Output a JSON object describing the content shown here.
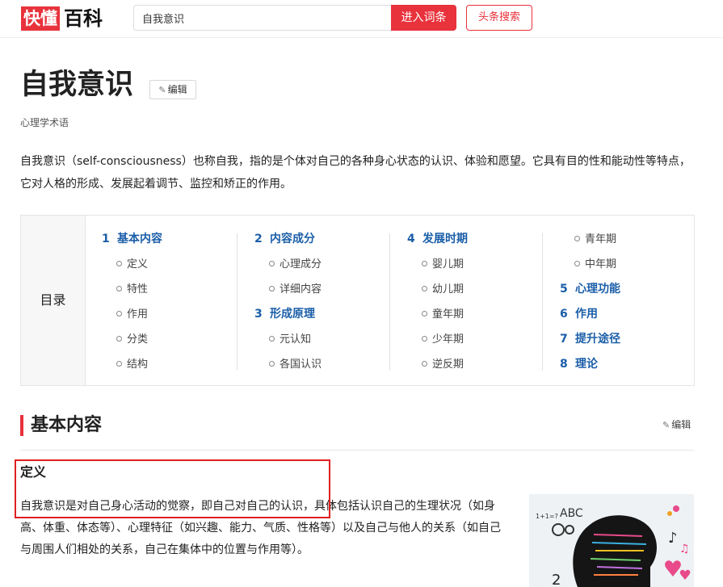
{
  "header": {
    "logo_red": "快懂",
    "logo_black": "百科",
    "search_value": "自我意识",
    "enter_label": "进入词条",
    "toutiao_label": "头条搜索"
  },
  "article": {
    "title": "自我意识",
    "edit_label": "编辑",
    "subtitle": "心理学术语",
    "summary": "自我意识（self-consciousness）也称自我，指的是个体对自己的各种身心状态的认识、体验和愿望。它具有目的性和能动性等特点，它对人格的形成、发展起着调节、监控和矫正的作用。"
  },
  "toc": {
    "label": "目录",
    "columns": [
      [
        {
          "level": 1,
          "num": "1",
          "text": "基本内容"
        },
        {
          "level": 2,
          "text": "定义"
        },
        {
          "level": 2,
          "text": "特性"
        },
        {
          "level": 2,
          "text": "作用"
        },
        {
          "level": 2,
          "text": "分类"
        },
        {
          "level": 2,
          "text": "结构"
        }
      ],
      [
        {
          "level": 1,
          "num": "2",
          "text": "内容成分"
        },
        {
          "level": 2,
          "text": "心理成分"
        },
        {
          "level": 2,
          "text": "详细内容"
        },
        {
          "level": 1,
          "num": "3",
          "text": "形成原理"
        },
        {
          "level": 2,
          "text": "元认知"
        },
        {
          "level": 2,
          "text": "各国认识"
        }
      ],
      [
        {
          "level": 1,
          "num": "4",
          "text": "发展时期"
        },
        {
          "level": 2,
          "text": "婴儿期"
        },
        {
          "level": 2,
          "text": "幼儿期"
        },
        {
          "level": 2,
          "text": "童年期"
        },
        {
          "level": 2,
          "text": "少年期"
        },
        {
          "level": 2,
          "text": "逆反期"
        }
      ],
      [
        {
          "level": 2,
          "text": "青年期"
        },
        {
          "level": 2,
          "text": "中年期"
        },
        {
          "level": 1,
          "num": "5",
          "text": "心理功能"
        },
        {
          "level": 1,
          "num": "6",
          "text": "作用"
        },
        {
          "level": 1,
          "num": "7",
          "text": "提升途径"
        },
        {
          "level": 1,
          "num": "8",
          "text": "理论"
        }
      ]
    ]
  },
  "section": {
    "title": "基本内容",
    "edit_label": "编辑",
    "sub_title": "定义",
    "paragraph": "自我意识是对自己身心活动的觉察，即自己对自己的认识，具体包括认识自己的生理状况（如身高、体重、体态等）、心理特征（如兴趣、能力、气质、性格等）以及自己与他人的关系（如自己与周围人们相处的关系，自己在集体中的位置与作用等）。"
  },
  "figure": {
    "label_abc": "ABC",
    "label_math": "1+1=?",
    "label_num": "2"
  },
  "colors": {
    "brand_red": "#e8323c",
    "toc_blue": "#1b5ea8",
    "highlight_red": "#e02020"
  }
}
